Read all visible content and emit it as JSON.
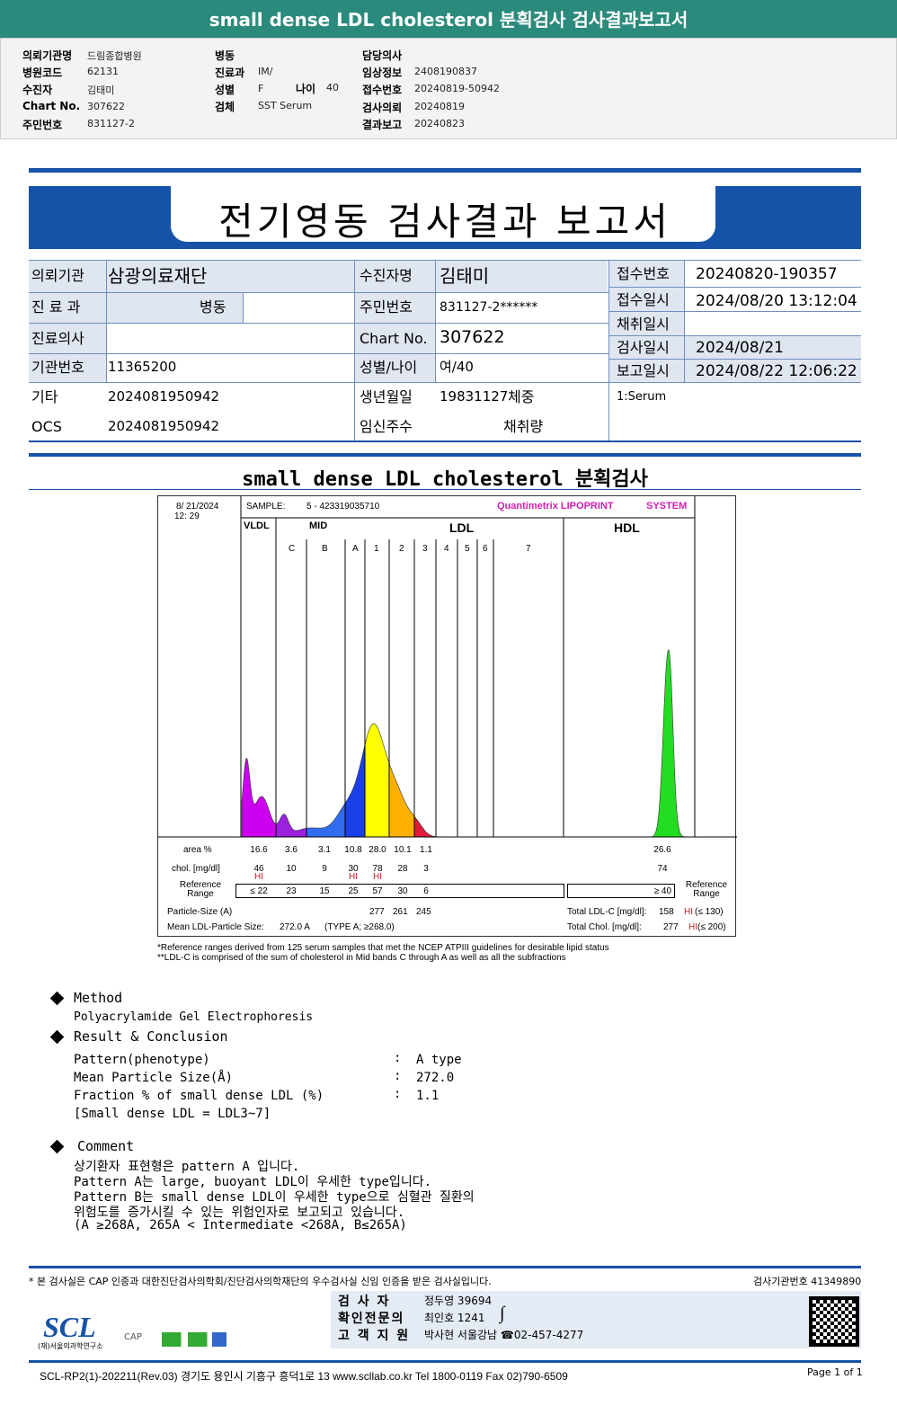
{
  "title": "small dense LDL cholesterol 분획검사 검사결과보고서",
  "info": {
    "c1": [
      [
        "의뢰기관명",
        "드림종합병원"
      ],
      [
        "병원코드",
        "62131"
      ],
      [
        "수진자",
        "김태미"
      ],
      [
        "Chart No.",
        "307622"
      ],
      [
        "주민번호",
        "831127-2"
      ]
    ],
    "c2": [
      [
        "병동",
        ""
      ],
      [
        "진료과",
        "IM/"
      ],
      [
        "성별",
        "F"
      ],
      [
        "검체",
        "SST Serum"
      ]
    ],
    "age_label": "나이",
    "age": "40",
    "c3": [
      [
        "담당의사",
        ""
      ],
      [
        "임상정보",
        "2408190837"
      ],
      [
        "접수번호",
        "20240819-50942"
      ],
      [
        "검사의뢰",
        "20240819"
      ],
      [
        "결과보고",
        "20240823"
      ]
    ]
  },
  "banner": "전기영동 검사결과 보고서",
  "table": {
    "inst_l": "의뢰기관",
    "inst": "삼광의료재단",
    "dept_l": "진 료 과",
    "ward_l": "병동",
    "doc_l": "진료의사",
    "code_l": "기관번호",
    "code": "11365200",
    "etc_l": "기타",
    "etc": "2024081950942",
    "ocs_l": "OCS",
    "ocs": "2024081950942",
    "name_l": "수진자명",
    "name": "김태미",
    "id_l": "주민번호",
    "id": "831127-2******",
    "chart_l": "Chart No.",
    "chart": "307622",
    "sex_l": "성별/나이",
    "sex": "여/40",
    "birth_l": "생년월일",
    "birth": "19831127",
    "weight_l": "체중",
    "preg_l": "임신주수",
    "vol_l": "채취량",
    "recv_no_l": "접수번호",
    "recv_no": "20240820-190357",
    "recv_l": "접수일시",
    "recv": "2024/08/20 13:12:04",
    "coll_l": "채취일시",
    "coll": "",
    "test_l": "검사일시",
    "test": "2024/08/21",
    "rep_l": "보고일시",
    "rep": "2024/08/22 12:06:22",
    "specimen": "1:Serum"
  },
  "subtitle": "small dense LDL cholesterol 분획검사",
  "chart_data": {
    "type": "area",
    "date": "8/ 21/2024",
    "time": "12: 29",
    "sample_label": "SAMPLE:",
    "sample": "5 - 423319035710",
    "brand": "Quantimetrix LIPOPRINT",
    "brand2": "SYSTEM",
    "groups": [
      "VLDL",
      "MID",
      "LDL",
      "HDL"
    ],
    "bands": [
      "C",
      "B",
      "A",
      "1",
      "2",
      "3",
      "4",
      "5",
      "6",
      "7"
    ],
    "colors": {
      "VLDL": "#cc00ee",
      "C": "#9a22dd",
      "B": "#2f6cf0",
      "A": "#1a3fe8",
      "1": "#ffff00",
      "2": "#ffb000",
      "3": "#e01a3a",
      "HDL": "#22dd22"
    },
    "area_label": "area %",
    "area": {
      "VLDL": "16.6",
      "C": "3.6",
      "B": "3.1",
      "A": "10.8",
      "1": "28.0",
      "2": "10.1",
      "3": "1.1",
      "HDL": "26.6"
    },
    "chol_label": "chol. [mg/dl]",
    "chol": {
      "VLDL": "46",
      "C": "10",
      "B": "9",
      "A": "30",
      "1": "78",
      "2": "28",
      "3": "3",
      "HDL": "74"
    },
    "hi_flags": [
      "VLDL",
      "A",
      "1"
    ],
    "hi": "HI",
    "ref_label": "Reference Range",
    "ref": {
      "VLDL": "≤ 22",
      "C": "23",
      "B": "15",
      "A": "25",
      "1": "57",
      "2": "30",
      "3": "6",
      "HDL": "≥ 40"
    },
    "ps_label": "Particle-Size (A)",
    "ps": [
      "277",
      "261",
      "245"
    ],
    "mean_label": "Mean LDL-Particle Size:",
    "mean": "272.0 A",
    "mean_type": "(TYPE A; ≥268.0)",
    "tldl_label": "Total LDL-C [mg/dl]:",
    "tldl": "158",
    "tldl_ref": "(≤ 130)",
    "tchol_label": "Total Chol. [mg/dl]:",
    "tchol": "277",
    "tchol_ref": "(≤ 200)"
  },
  "notes": [
    "*Reference ranges derived from 125 serum samples that met the NCEP ATPIII guidelines for desirable lipid status",
    "**LDL-C is comprised of the sum of cholesterol in Mid bands C through A as well as all the subfractions"
  ],
  "method": {
    "h": "Method",
    "v": "Polyacrylamide Gel Electrophoresis"
  },
  "result": {
    "h": "Result & Conclusion",
    "rows": [
      [
        "Pattern(phenotype)",
        "A type"
      ],
      [
        "Mean Particle Size(Å)",
        "272.0"
      ],
      [
        "Fraction % of small dense LDL (%)",
        "1.1"
      ]
    ],
    "note": "[Small dense LDL = LDL3~7]"
  },
  "comment": {
    "h": "Comment",
    "lines": [
      "상기환자 표현형은 pattern A 입니다.",
      "Pattern A는 large, buoyant LDL이 우세한 type입니다.",
      "Pattern B는 small dense LDL이 우세한 type으로 심혈관 질환의",
      "위험도를 증가시킬 수 있는 위험인자로 보고되고 있습니다.",
      "(A ≥268A, 265A < Intermediate <268A, B≤265A)"
    ]
  },
  "footer": {
    "cert": "* 본 검사실은 CAP 인증과 대한진단검사의학회/진단검사의학재단의 우수검사실 신임 인증을 받은 검사실입니다.",
    "lab_no": "검사기관번호 41349890",
    "staff": [
      [
        "검 사 자",
        "정두영 39694"
      ],
      [
        "확인전문의",
        "최인호 1241"
      ],
      [
        "고 객 지 원",
        "박사현 서울강남 ☎02-457-4277"
      ]
    ],
    "logo": "SCL",
    "logo_sub": "(재)서울의과학연구소",
    "accred": "CAP",
    "address": "SCL-RP2(1)-202211(Rev.03) 경기도 용인시 기흥구 흥덕1로 13 www.scllab.co.kr Tel 1800-0119 Fax 02)790-6509",
    "page": "Page 1 of 1"
  }
}
